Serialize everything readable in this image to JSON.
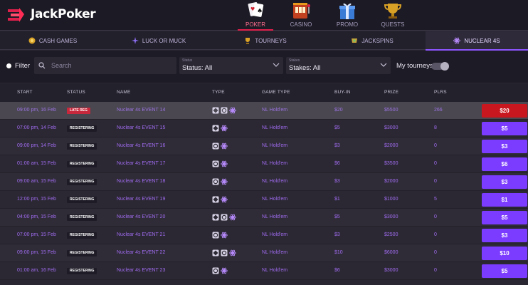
{
  "brand": {
    "name": "JackPoker"
  },
  "topnav": [
    {
      "label": "POKER",
      "icon": "poker-cards-icon",
      "active": true
    },
    {
      "label": "CASINO",
      "icon": "slot-machine-icon",
      "active": false
    },
    {
      "label": "PROMO",
      "icon": "gift-icon",
      "active": false
    },
    {
      "label": "QUESTS",
      "icon": "trophy-icon",
      "active": false
    }
  ],
  "subnav": [
    {
      "label": "CASH GAMES",
      "icon": "chip-icon",
      "active": false
    },
    {
      "label": "LUCK OR MUCK",
      "icon": "sparkle-icon",
      "active": false
    },
    {
      "label": "TOURNEYS",
      "icon": "trophy-icon",
      "active": false
    },
    {
      "label": "JACKSPINS",
      "icon": "spin-icon",
      "active": false
    },
    {
      "label": "NUCLEAR 4S",
      "icon": "nuclear-icon",
      "active": true
    }
  ],
  "filters": {
    "filter_label": "Filter",
    "search_placeholder": "Search",
    "status": {
      "caption": "Status",
      "value": "Status: All"
    },
    "stakes": {
      "caption": "Stakes",
      "value": "Stakes: All"
    },
    "my_tourneys": "My tourneys",
    "my_tourneys_on": false
  },
  "columns": {
    "start": "START",
    "status": "STATUS",
    "name": "NAME",
    "type": "TYPE",
    "game_type": "GAME TYPE",
    "buy_in": "BUY-IN",
    "prize": "PRIZE",
    "plrs": "PLRS"
  },
  "rows": [
    {
      "start": "09:00 pm, 16 Feb",
      "status": "LATE REG",
      "name": "Nuclear 4s EVENT 14",
      "game_type": "NL Hold'em",
      "buy_in": "$20",
      "prize": "$5500",
      "plrs": "266",
      "button": "$20"
    },
    {
      "start": "07:00 pm, 14 Feb",
      "status": "REGISTERING",
      "name": "Nuclear 4s EVENT 15",
      "game_type": "NL Hold'em",
      "buy_in": "$5",
      "prize": "$3000",
      "plrs": "8",
      "button": "$5"
    },
    {
      "start": "09:00 pm, 14 Feb",
      "status": "REGISTERING",
      "name": "Nuclear 4s EVENT 16",
      "game_type": "NL Hold'em",
      "buy_in": "$3",
      "prize": "$2000",
      "plrs": "0",
      "button": "$3"
    },
    {
      "start": "01:00 am, 15 Feb",
      "status": "REGISTERING",
      "name": "Nuclear 4s EVENT 17",
      "game_type": "NL Hold'em",
      "buy_in": "$6",
      "prize": "$3500",
      "plrs": "0",
      "button": "$6"
    },
    {
      "start": "09:00 am, 15 Feb",
      "status": "REGISTERING",
      "name": "Nuclear 4s EVENT 18",
      "game_type": "NL Hold'em",
      "buy_in": "$3",
      "prize": "$2000",
      "plrs": "0",
      "button": "$3"
    },
    {
      "start": "12:00 pm, 15 Feb",
      "status": "REGISTERING",
      "name": "Nuclear 4s EVENT 19",
      "game_type": "NL Hold'em",
      "buy_in": "$1",
      "prize": "$1000",
      "plrs": "5",
      "button": "$1"
    },
    {
      "start": "04:00 pm, 15 Feb",
      "status": "REGISTERING",
      "name": "Nuclear 4s EVENT 20",
      "game_type": "NL Hold'em",
      "buy_in": "$5",
      "prize": "$3000",
      "plrs": "0",
      "button": "$5"
    },
    {
      "start": "07:00 pm, 15 Feb",
      "status": "REGISTERING",
      "name": "Nuclear 4s EVENT 21",
      "game_type": "NL Hold'em",
      "buy_in": "$3",
      "prize": "$2500",
      "plrs": "0",
      "button": "$3"
    },
    {
      "start": "09:00 pm, 15 Feb",
      "status": "REGISTERING",
      "name": "Nuclear 4s EVENT 22",
      "game_type": "NL Hold'em",
      "buy_in": "$10",
      "prize": "$6000",
      "plrs": "0",
      "button": "$10"
    },
    {
      "start": "01:00 am, 16 Feb",
      "status": "REGISTERING",
      "name": "Nuclear 4s EVENT 23",
      "game_type": "NL Hold'em",
      "buy_in": "$6",
      "prize": "$3000",
      "plrs": "0",
      "button": "$5"
    }
  ],
  "colors": {
    "accent": "#7b3cff",
    "late": "#c8171e",
    "brand": "#e0204c"
  }
}
